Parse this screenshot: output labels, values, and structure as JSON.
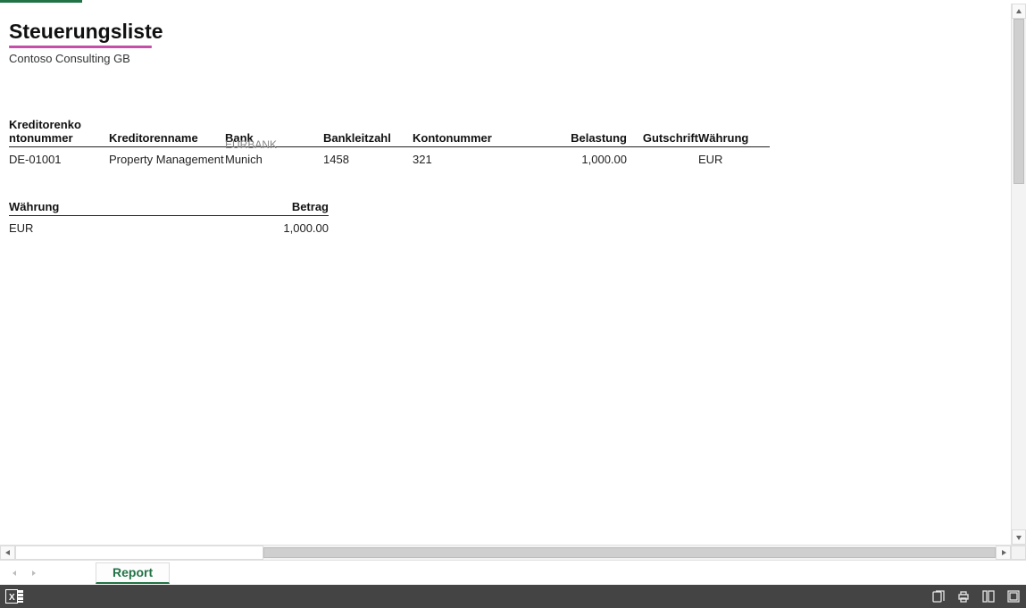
{
  "title": "Steuerungsliste",
  "subtitle": "Contoso Consulting GB",
  "table": {
    "headers": {
      "kreditorenkontonummer": "Kreditorenkontonummer",
      "kreditorenname": "Kreditorenname",
      "bank": "Bank",
      "bankleitzahl": "Bankleitzahl",
      "kontonummer": "Kontonummer",
      "belastung": "Belastung",
      "gutschrift": "Gutschrift",
      "waehrung": "Währung"
    },
    "rows": [
      {
        "kreditorenkontonummer": "DE-01001",
        "kreditorenname": "Property Management",
        "bank_ghost": "EURBANK",
        "bank": "Munich",
        "bankleitzahl": "1458",
        "kontonummer": "321",
        "belastung": "1,000.00",
        "gutschrift": "",
        "waehrung": "EUR"
      }
    ]
  },
  "summary": {
    "headers": {
      "waehrung": "Währung",
      "betrag": "Betrag"
    },
    "rows": [
      {
        "waehrung": "EUR",
        "betrag": "1,000.00"
      }
    ]
  },
  "tabs": {
    "active": "Report"
  }
}
